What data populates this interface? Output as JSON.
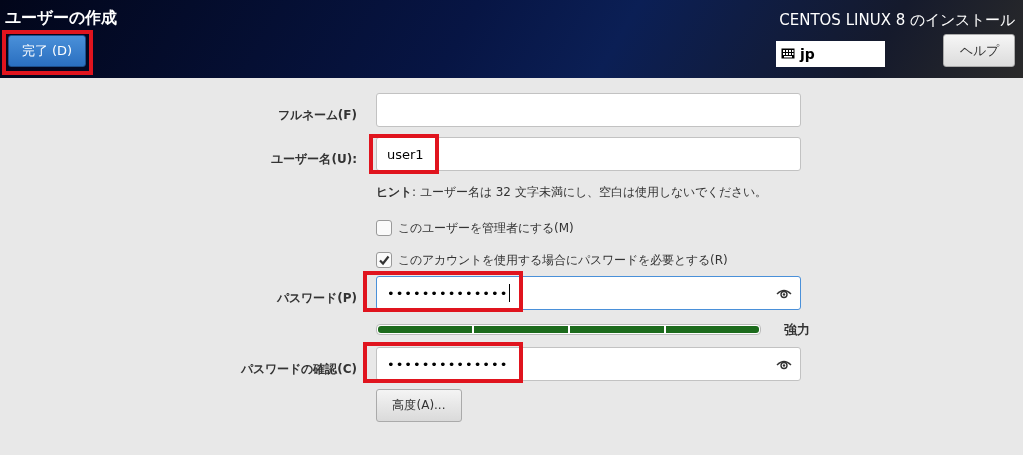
{
  "header": {
    "title": "ユーザーの作成",
    "done_button": {
      "label": "完了 (D)",
      "highlighted": true
    },
    "product": "CENTOS LINUX 8 のインストール",
    "keyboard_layout": "jp",
    "help_button": "ヘルプ"
  },
  "full_name": {
    "label": "フルネーム(F)"
  },
  "user_name": {
    "label": "ユーザー名(U):",
    "value": "user1",
    "highlighted": true
  },
  "hint": "**ヒント**: ユーザー名は 32 文字未満にし、空白は使用しないでください。",
  "checkboxes": [
    {
      "label": "このユーザーを管理者にする(M)",
      "checked": false
    },
    {
      "label": "このアカウントを使用する場合にパスワードを必要とする(R)",
      "checked": true
    }
  ],
  "password": {
    "label": "パスワード(P)",
    "value": "••••••••••••••",
    "focused": true,
    "highlighted": true
  },
  "strength": {
    "level": 1,
    "label": "強力"
  },
  "confirm": {
    "label": "パスワードの確認(C)",
    "value": "••••••••••••••",
    "focused": false,
    "highlighted": true
  },
  "advanced_button": "高度(A)..."
}
